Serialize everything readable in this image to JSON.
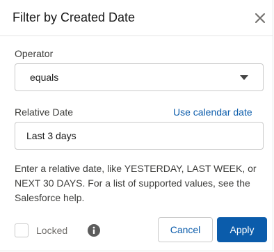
{
  "dialog": {
    "title": "Filter by Created Date",
    "close_icon": "close-icon"
  },
  "operator": {
    "label": "Operator",
    "selected": "equals",
    "dropdown_icon": "chevron-down-icon"
  },
  "relative_date": {
    "label": "Relative Date",
    "calendar_link": "Use calendar date",
    "value": "Last 3 days"
  },
  "help_text": "Enter a relative date, like YESTERDAY, LAST WEEK, or NEXT 30 DAYS. For a list of supported values, see the Salesforce help.",
  "footer": {
    "locked_label": "Locked",
    "locked_checked": false,
    "info_icon": "info-icon",
    "cancel_label": "Cancel",
    "apply_label": "Apply"
  },
  "colors": {
    "brand": "#0b5cab",
    "border": "#c9c9c9",
    "text": "#181818"
  }
}
